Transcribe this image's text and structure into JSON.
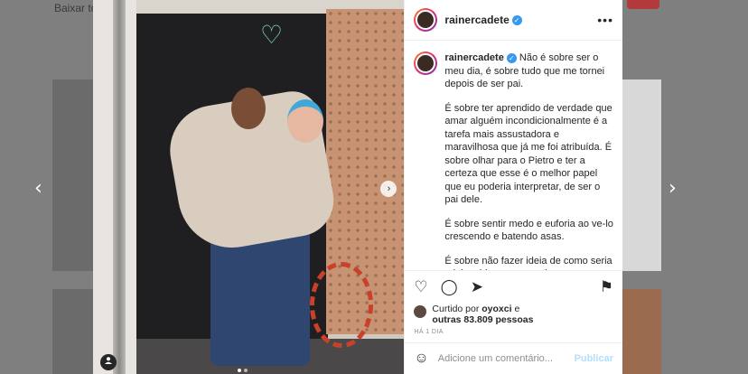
{
  "background": {
    "top_text": "Baixar to"
  },
  "post": {
    "username": "rainercadete",
    "verified_mark": "✓",
    "more_icon": "•••",
    "caption": [
      "Não é sobre ser o meu dia, é sobre tudo que me tornei depois de ser pai.",
      "É sobre ter aprendido de verdade que amar alguém incondicionalmente é a tarefa mais assustadora e maravilhosa que já me foi atribuída. É sobre olhar para o Pietro e ter a certeza que esse é o melhor papel que eu poderia interpretar, de ser o pai dele.",
      "É sobre sentir medo e euforia ao ve-lo crescendo e batendo asas.",
      "É sobre não fazer ideia de como seria minha vida sem ser pai."
    ],
    "liked_by_prefix": "Curtido por ",
    "liked_by_user": "oyoxci",
    "liked_by_join": " e",
    "liked_by_others": "outras 83.809 pessoas",
    "time": "HÁ 1 DIA",
    "comment_placeholder": "Adicione um comentário...",
    "publish_label": "Publicar"
  },
  "icons": {
    "heart": "♡",
    "comment": "◯",
    "share": "➤",
    "save": "⚑",
    "emoji": "☺",
    "prev": "‹",
    "next": "›",
    "photo_next": "›",
    "tag": "👤",
    "wall_heart": "♡"
  },
  "colors": {
    "accent": "#3897f0",
    "publish_disabled": "#b2dffc"
  }
}
